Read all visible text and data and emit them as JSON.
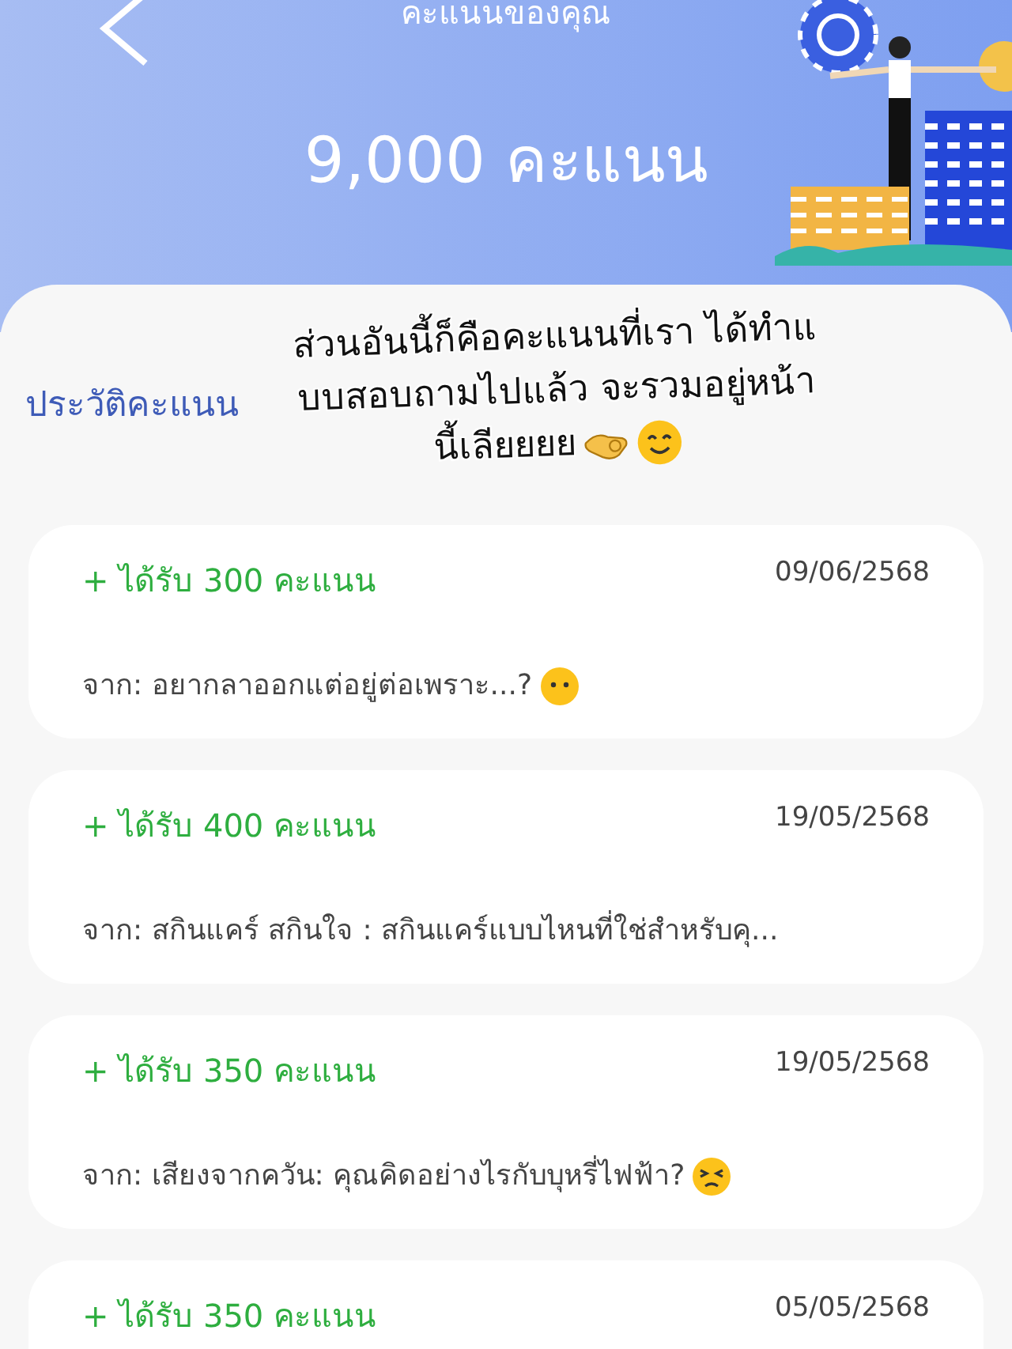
{
  "header": {
    "title": "คะแนนของคุณ",
    "total": "9,000 คะแนน"
  },
  "annotation": {
    "lines": [
      "ส่วนอันนี้ก็คือคะแนนที่เรา ได้ทำแ",
      "บบสอบถามไปแล้ว จะรวมอยู่หน้า",
      "นี้เลียยยย"
    ]
  },
  "history": {
    "title": "ประวัติคะแนน",
    "items": [
      {
        "points": "+ ได้รับ 300 คะแนน",
        "date": "09/06/2568",
        "source": "จาก: อยากลาออกแต่อยู่ต่อเพราะ...?",
        "kind": "neutral"
      },
      {
        "points": "+ ได้รับ 400 คะแนน",
        "date": "19/05/2568",
        "source": "จาก: สกินแคร์ สกินใจ : สกินแคร์แบบไหนที่ใช่สำหรับคุ...",
        "kind": "plain"
      },
      {
        "points": "+ ได้รับ 350 คะแนน",
        "date": "19/05/2568",
        "source": "จาก: เสียงจากควัน: คุณคิดอย่างไรกับบุหรี่ไฟฟ้า?",
        "kind": "tired"
      },
      {
        "points": "+ ได้รับ 350 คะแนน",
        "date": "05/05/2568"
      }
    ]
  }
}
